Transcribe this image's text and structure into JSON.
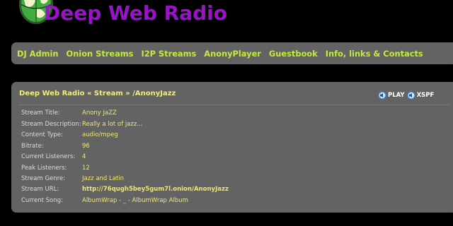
{
  "header": {
    "site_title": "Deep Web Radio",
    "logo_icon": "globe-logo-icon"
  },
  "nav": {
    "items": [
      {
        "label": "DJ Admin"
      },
      {
        "label": "Onion Streams"
      },
      {
        "label": "I2P Streams"
      },
      {
        "label": "AnonyPlayer"
      },
      {
        "label": "Guestbook"
      },
      {
        "label": "Info, links & Contacts"
      }
    ]
  },
  "panel": {
    "title": "Deep Web Radio « Stream » /AnonyJazz",
    "play_label": "PLAY",
    "xspf_label": "XSPF",
    "play_icon": "speaker-play-icon",
    "xspf_icon": "speaker-playlist-icon",
    "rows": [
      {
        "label": "Stream Title:",
        "value": "Anony JaZZ"
      },
      {
        "label": "Stream Description:",
        "value": "Really a lot of jazz..."
      },
      {
        "label": "Content Type:",
        "value": "audio/mpeg"
      },
      {
        "label": "Bitrate:",
        "value": "96"
      },
      {
        "label": "Current Listeners:",
        "value": "4"
      },
      {
        "label": "Peak Listeners:",
        "value": "12"
      },
      {
        "label": "Stream Genre:",
        "value": "Jazz and Latin"
      },
      {
        "label": "Stream URL:",
        "value": "http://76qugh5bey5gum7l.onion/AnonyJazz"
      },
      {
        "label": "Current Song:",
        "value": "AlbumWrap - _ - AlbumWrap Album"
      }
    ]
  },
  "colors": {
    "background": "#000000",
    "title": "#9a13c9",
    "nav_link": "#c3ea3e",
    "panel_bg": "#636363",
    "panel_title": "#f2ec7c",
    "value_text": "#f0e76a"
  }
}
